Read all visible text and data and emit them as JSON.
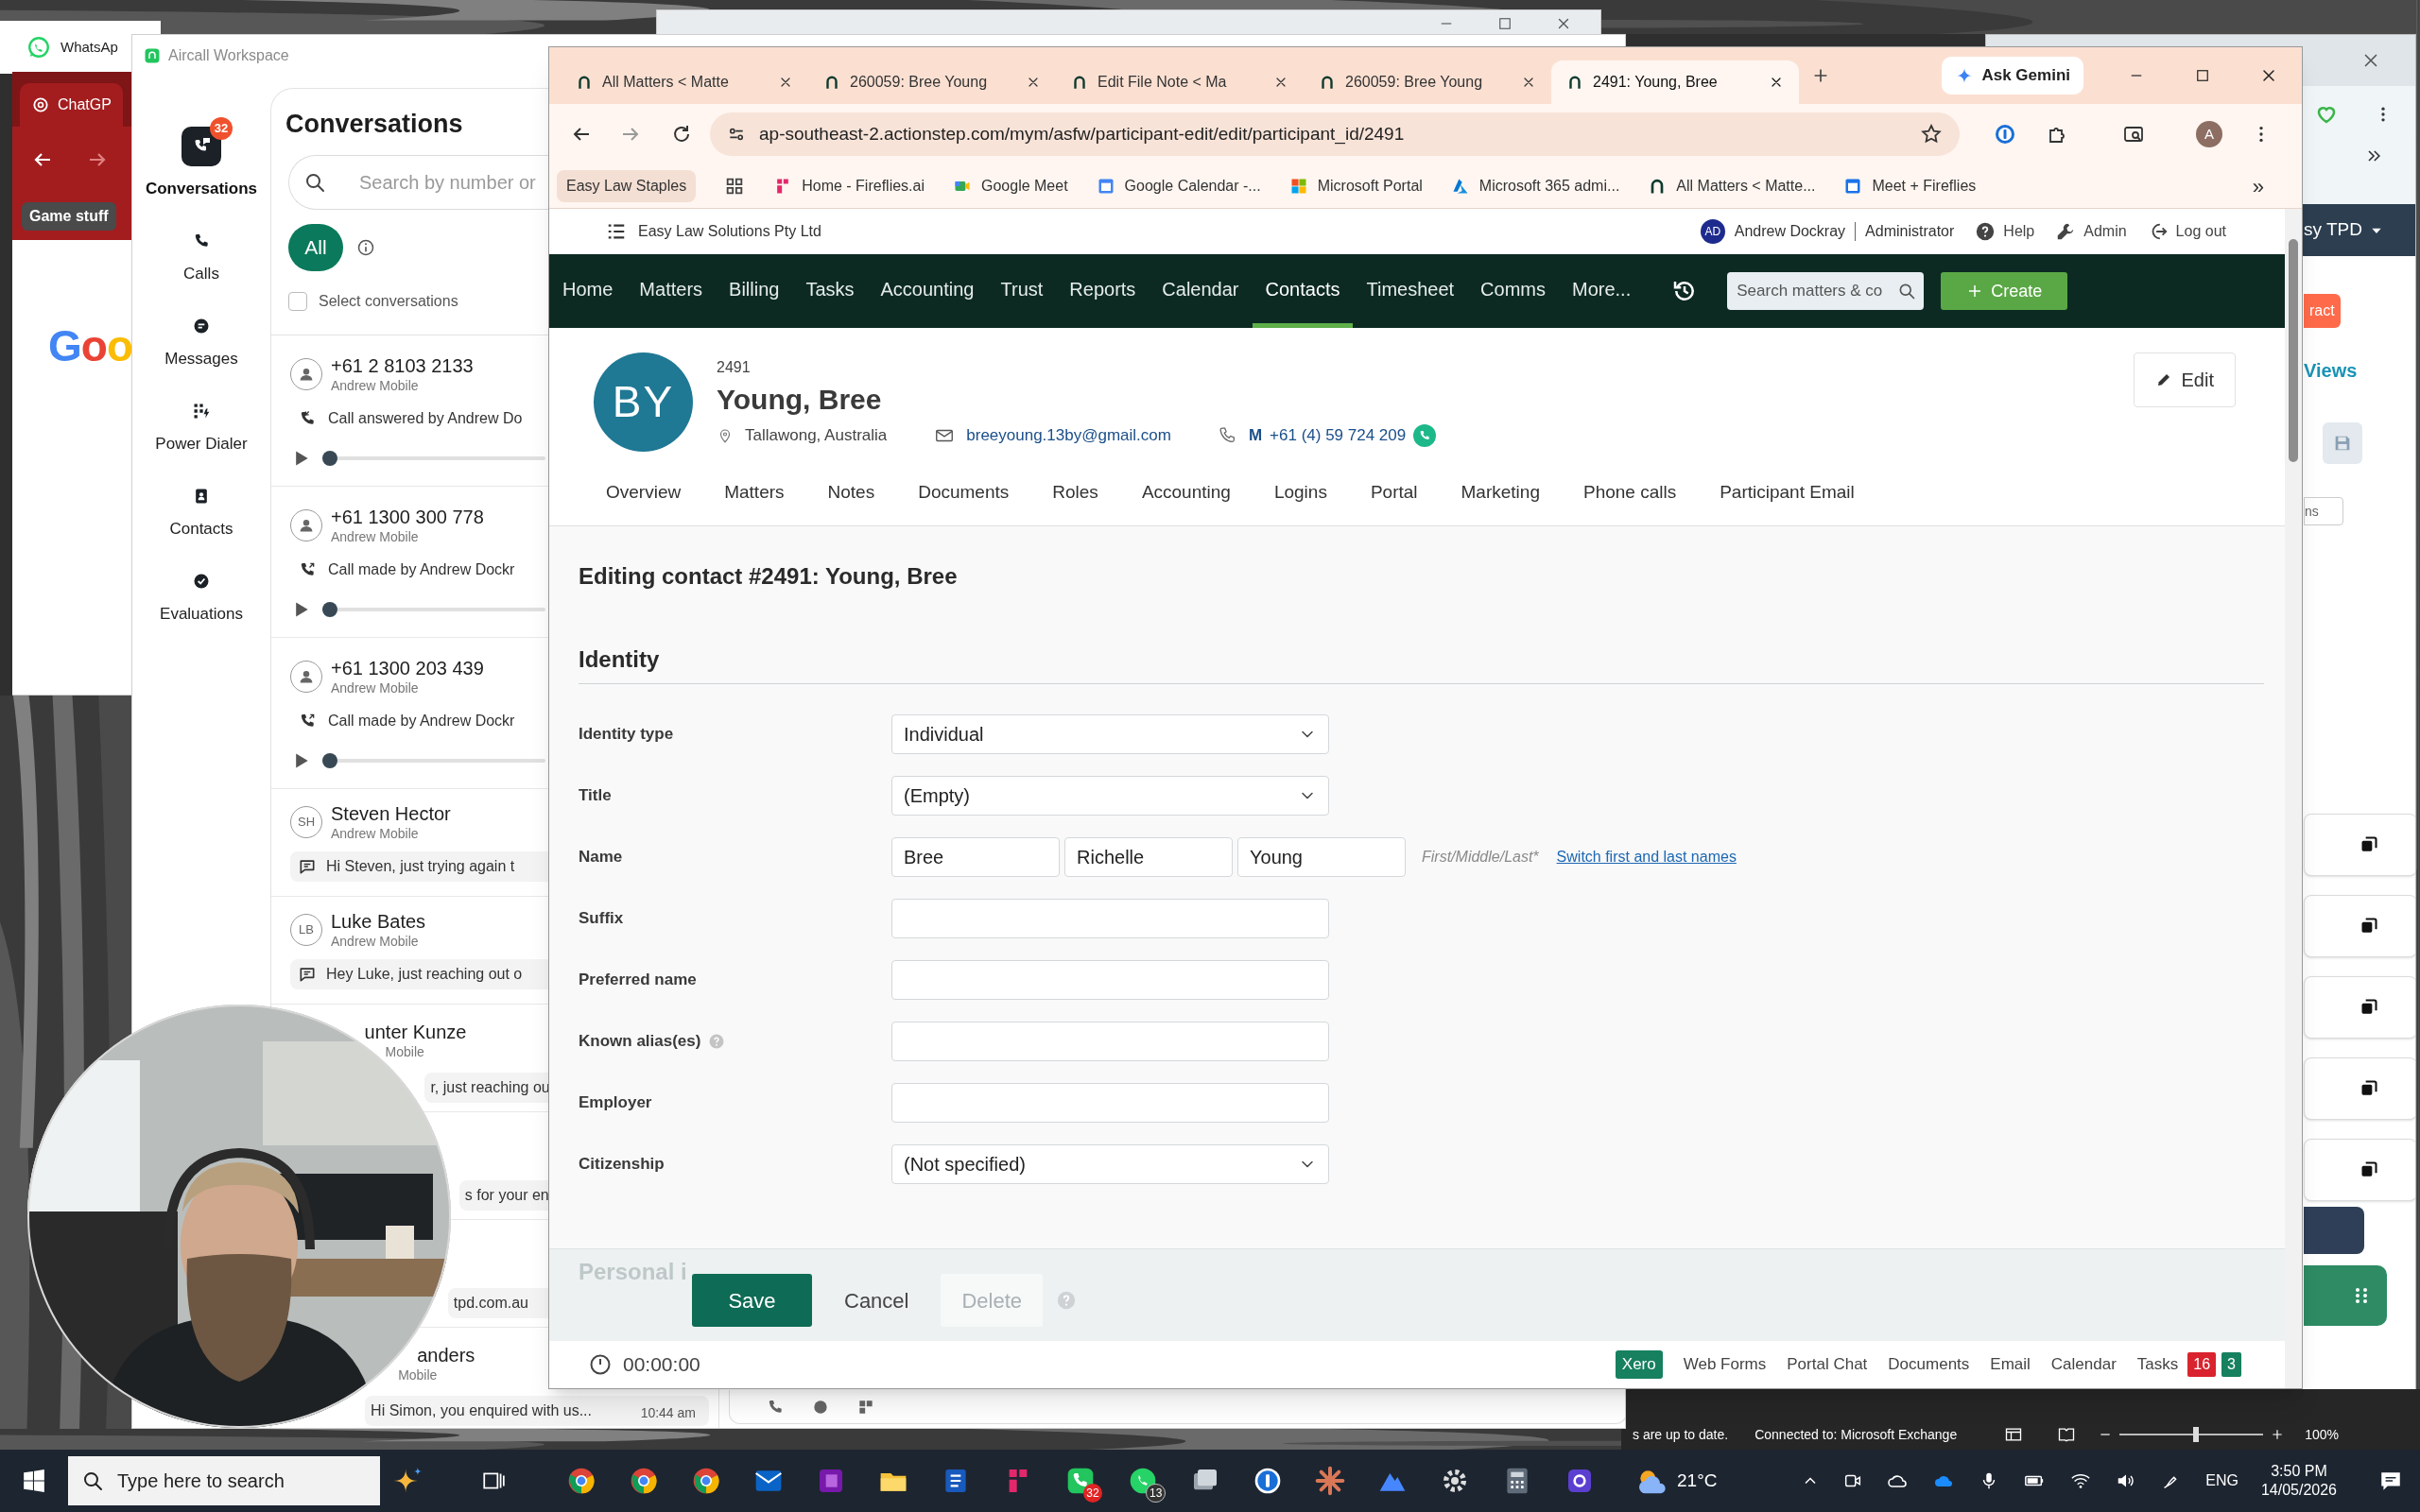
{
  "whatsapp_window": {
    "title": "WhatsAp"
  },
  "chatgpt_window": {
    "tab": "ChatGP",
    "bookmark": "Game stuff",
    "logo": "Goo"
  },
  "aircall": {
    "title": "Aircall Workspace",
    "nav": [
      {
        "kind": "conversations",
        "label": "Conversations",
        "badge": "32",
        "selected": true
      },
      {
        "kind": "calls",
        "label": "Calls",
        "selected": false
      },
      {
        "kind": "messages",
        "label": "Messages",
        "selected": false
      },
      {
        "kind": "dialer",
        "label": "Power Dialer",
        "selected": false
      },
      {
        "kind": "contacts",
        "label": "Contacts",
        "selected": false
      },
      {
        "kind": "evaluations",
        "label": "Evaluations",
        "selected": false
      }
    ],
    "heading": "Conversations",
    "search": {
      "placeholder": "Search by number or"
    },
    "filter": {
      "label": "All",
      "selected": true
    },
    "select": {
      "label": "Select conversations",
      "checked": false
    },
    "conversations": [
      {
        "kind": "call_in",
        "name": "+61 2 8103 2133",
        "line": "Andrew Mobile",
        "summary": "Call answered by Andrew Do",
        "level": 0
      },
      {
        "kind": "call_out",
        "name": "+61 1300 300 778",
        "line": "Andrew Mobile",
        "summary": "Call made by Andrew Dockr",
        "level": 0
      },
      {
        "kind": "call_out",
        "name": "+61 1300 203 439",
        "line": "Andrew Mobile",
        "summary": "Call made by Andrew Dockr",
        "level": 0
      },
      {
        "kind": "message",
        "initials": "SH",
        "name": "Steven Hector",
        "line": "Andrew Mobile",
        "summary": "Hi Steven, just trying again t"
      },
      {
        "kind": "message",
        "initials": "LB",
        "name": "Luke Bates",
        "line": "Andrew Mobile",
        "summary": "Hey Luke, just reaching out o"
      },
      {
        "kind": "covered",
        "name": "unter Kunze",
        "line": "Mobile",
        "summary": "r, just reaching ou"
      },
      {
        "kind": "covered",
        "summary": "s for your en"
      },
      {
        "kind": "covered",
        "summary": "tpd.com.au"
      },
      {
        "kind": "covered",
        "name": "anders",
        "line": "Mobile",
        "summary": "Hi Simon, you enquired with us...",
        "time": "10:44 am"
      }
    ]
  },
  "browser": {
    "tabs": [
      {
        "title": "All Matters < Matte",
        "selected": false
      },
      {
        "title": "260059: Bree Young",
        "selected": false
      },
      {
        "title": "Edit File Note < Ma",
        "selected": false
      },
      {
        "title": "260059: Bree Young",
        "selected": false
      },
      {
        "title": "2491: Young, Bree",
        "selected": true
      }
    ],
    "ask_gemini": "Ask Gemini",
    "url": "ap-southeast-2.actionstep.com/mym/asfw/participant-edit/edit/participant_id/2491",
    "profile": "A",
    "bookmarks": [
      {
        "kind": "folder",
        "label": "Easy Law Staples"
      },
      {
        "kind": "apps"
      },
      {
        "kind": "fireflies",
        "label": "Home - Fireflies.ai"
      },
      {
        "kind": "meet",
        "label": "Google Meet"
      },
      {
        "kind": "calendar",
        "label": "Google Calendar -..."
      },
      {
        "kind": "windows",
        "label": "Microsoft Portal"
      },
      {
        "kind": "azure",
        "label": "Microsoft 365 admi..."
      },
      {
        "kind": "actionstep",
        "label": "All Matters < Matte..."
      },
      {
        "kind": "calendar2",
        "label": "Meet + Fireflies"
      }
    ],
    "bookmarks_more": "»"
  },
  "actionstep": {
    "org": "Easy Law Solutions Pty Ltd",
    "user": {
      "initials": "AD",
      "name": "Andrew Dockray",
      "role": "Administrator"
    },
    "links": [
      {
        "kind": "help",
        "label": "Help"
      },
      {
        "kind": "admin",
        "label": "Admin"
      },
      {
        "kind": "logout",
        "label": "Log out"
      }
    ],
    "nav": [
      {
        "label": "Home",
        "selected": false
      },
      {
        "label": "Matters",
        "selected": false
      },
      {
        "label": "Billing",
        "selected": false
      },
      {
        "label": "Tasks",
        "selected": false
      },
      {
        "label": "Accounting",
        "selected": false
      },
      {
        "label": "Trust",
        "selected": false
      },
      {
        "label": "Reports",
        "selected": false
      },
      {
        "label": "Calendar",
        "selected": false
      },
      {
        "label": "Contacts",
        "selected": true
      },
      {
        "label": "Timesheet",
        "selected": false
      },
      {
        "label": "Comms",
        "selected": false
      },
      {
        "label": "More...",
        "selected": false
      }
    ],
    "search": {
      "placeholder": "Search matters & co"
    },
    "create": "Create",
    "contact": {
      "id": "2491",
      "name": "Young, Bree",
      "initials": "BY",
      "location": "Tallawong, Australia",
      "email": "breeyoung.13by@gmail.com",
      "phone_type": "M",
      "phone": "+61 (4) 59 724 209"
    },
    "edit": "Edit",
    "subtabs": [
      {
        "label": "Overview",
        "selected": false
      },
      {
        "label": "Matters",
        "selected": false
      },
      {
        "label": "Notes",
        "selected": false
      },
      {
        "label": "Documents",
        "selected": false
      },
      {
        "label": "Roles",
        "selected": false
      },
      {
        "label": "Accounting",
        "selected": false
      },
      {
        "label": "Logins",
        "selected": false
      },
      {
        "label": "Portal",
        "selected": false
      },
      {
        "label": "Marketing",
        "selected": false
      },
      {
        "label": "Phone calls",
        "selected": false
      },
      {
        "label": "Participant Email",
        "selected": false
      }
    ],
    "form": {
      "title": "Editing contact #2491: Young, Bree",
      "section": "Identity",
      "fields": [
        {
          "kind": "select",
          "label": "Identity type",
          "value": "Individual"
        },
        {
          "kind": "select",
          "label": "Title",
          "value": "(Empty)"
        },
        {
          "kind": "name",
          "label": "Name",
          "values": [
            "Bree",
            "Richelle",
            "Young"
          ],
          "hint": "First/Middle/Last*",
          "link": "Switch first and last names"
        },
        {
          "kind": "text",
          "label": "Suffix"
        },
        {
          "kind": "text",
          "label": "Preferred name"
        },
        {
          "kind": "text",
          "label": "Known alias(es)",
          "help": true
        },
        {
          "kind": "text",
          "label": "Employer"
        },
        {
          "kind": "select",
          "label": "Citizenship",
          "value": "(Not specified)"
        }
      ],
      "next_section": "Personal i"
    },
    "actions": [
      {
        "kind": "primary",
        "label": "Save",
        "disabled": false
      },
      {
        "kind": "plain",
        "label": "Cancel",
        "disabled": false
      },
      {
        "kind": "plain",
        "label": "Delete",
        "disabled": true
      }
    ],
    "footer": {
      "timer": "00:00:00",
      "links": [
        {
          "kind": "badge",
          "label": "Xero"
        },
        {
          "kind": "link",
          "label": "Web Forms"
        },
        {
          "kind": "link",
          "label": "Portal Chat"
        },
        {
          "kind": "link",
          "label": "Documents"
        },
        {
          "kind": "link",
          "label": "Email"
        },
        {
          "kind": "link",
          "label": "Calendar"
        },
        {
          "kind": "link",
          "label": "Tasks"
        }
      ],
      "task_counts": [
        {
          "value": "16",
          "color": "#d9232e"
        },
        {
          "value": "3",
          "color": "#17805f"
        }
      ]
    }
  },
  "right_window": {
    "menu": "sy TPD",
    "button": "ract",
    "tab": "Views",
    "field": "ns"
  },
  "outlook_status": {
    "sync": "s are up to date.",
    "connection": "Connected to: Microsoft Exchange",
    "zoom": {
      "label": "100%",
      "level": 0.53
    }
  },
  "taskbar": {
    "search": {
      "placeholder": "Type here to search"
    },
    "apps": [
      {
        "kind": "chrome"
      },
      {
        "kind": "chrome"
      },
      {
        "kind": "chrome"
      },
      {
        "kind": "outlook"
      },
      {
        "kind": "onenote"
      },
      {
        "kind": "explorer"
      },
      {
        "kind": "word"
      },
      {
        "kind": "fireflies"
      },
      {
        "kind": "aircall",
        "badge": "32"
      },
      {
        "kind": "whatsapp",
        "badge": "13"
      },
      {
        "kind": "photos"
      },
      {
        "kind": "password"
      },
      {
        "kind": "starburst"
      },
      {
        "kind": "vpn"
      },
      {
        "kind": "settings"
      },
      {
        "kind": "calculator"
      },
      {
        "kind": "other"
      }
    ],
    "temperature": "21°C",
    "language": "ENG",
    "time": "3:50 PM",
    "date": "14/05/2026"
  }
}
